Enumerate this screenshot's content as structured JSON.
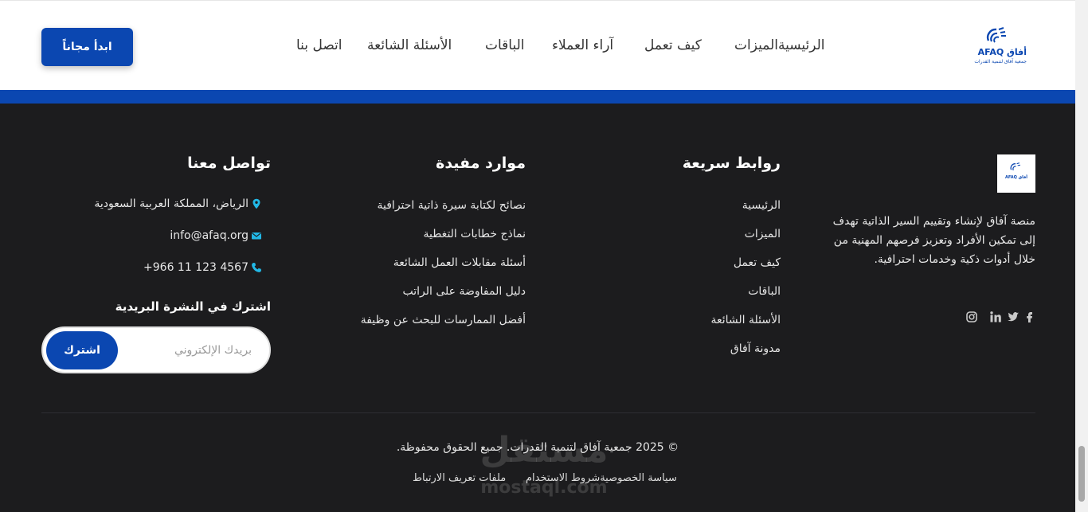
{
  "header": {
    "cta_label": "ابدأ مجاناً",
    "nav": [
      {
        "label": "الرئيسيةالميزات"
      },
      {
        "label": "كيف تعمل"
      },
      {
        "label": "آراء العملاء"
      },
      {
        "label": "الباقات"
      },
      {
        "label": "الأسئلة الشائعة"
      },
      {
        "label": "اتصل بنا"
      }
    ],
    "logo": {
      "word": "AFAQ أفاق",
      "tagline": "جمعية آفاق لتنمية القدرات"
    }
  },
  "footer": {
    "about": {
      "logo_text": "AFAQ أفاق",
      "text": "منصة آفاق لإنشاء وتقييم السير الذاتية تهدف إلى تمكين الأفراد وتعزيز فرصهم المهنية من خلال أدوات ذكية وخدمات احترافية.",
      "social": [
        "facebook-icon",
        "twitter-icon",
        "linkedin-icon",
        "instagram-icon"
      ]
    },
    "quick_links": {
      "title": "روابط سريعة",
      "items": [
        "الرئيسية",
        "الميزات",
        "كيف تعمل",
        "الباقات",
        "الأسئلة الشائعة",
        "مدونة آفاق"
      ]
    },
    "resources": {
      "title": "موارد مفيدة",
      "items": [
        "نصائح لكتابة سيرة ذاتية احترافية",
        "نماذج خطابات التغطية",
        "أسئلة مقابلات العمل الشائعة",
        "دليل المفاوضة على الراتب",
        "أفضل الممارسات للبحث عن وظيفة"
      ]
    },
    "contact": {
      "title": "تواصل معنا",
      "address": "الرياض، المملكة العربية السعودية",
      "email": "info@afaq.org",
      "phone": "+966 11 123 4567"
    },
    "newsletter": {
      "title": "اشترك في النشرة البريدية",
      "placeholder": "بريدك الإلكتروني",
      "button": "اشترك"
    },
    "copyright": "© 2025 جمعية آفاق لتنمية القدرات. جميع الحقوق محفوظة.",
    "bottom_links": [
      "سياسة الخصوصيةشروط الاستخدام",
      "ملفات تعريف الارتباط"
    ]
  },
  "watermark": {
    "arabic": "مستقل",
    "latin": "mostaql.com"
  },
  "colors": {
    "brand_blue": "#0b47b1",
    "footer_bg": "#1c1c1e",
    "accent_cyan": "#22b8e6"
  }
}
